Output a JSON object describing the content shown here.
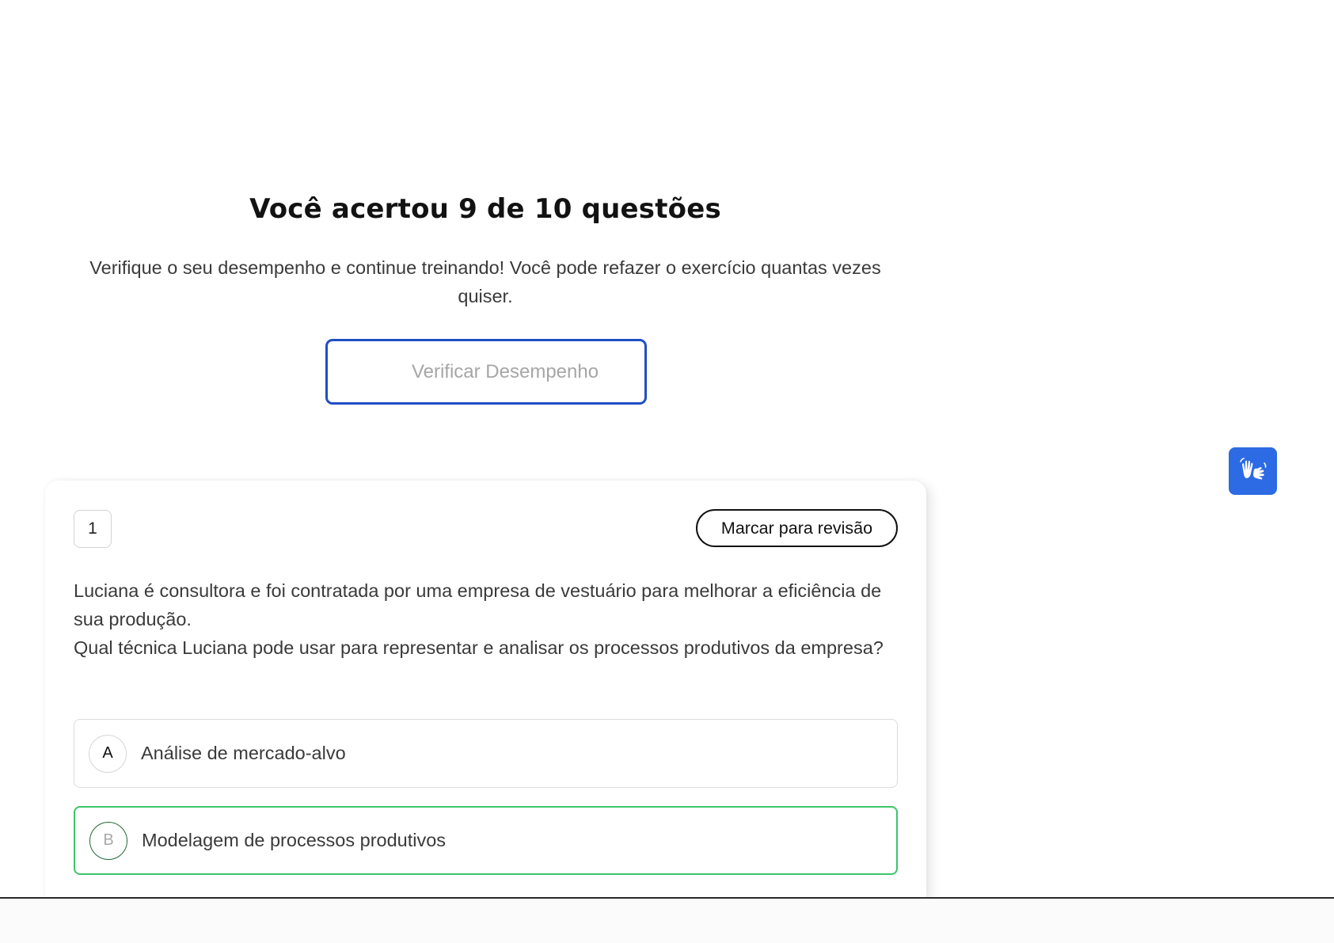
{
  "result": {
    "title": "Você acertou 9 de 10 questões",
    "description": "Verifique o seu desempenho e continue treinando! Você pode refazer o exercício quantas vezes quiser.",
    "verify_button_label": "Verificar Desempenho"
  },
  "accessibility": {
    "libras_icon": "sign-language-hands-icon",
    "accent_color": "#2c6be3"
  },
  "question": {
    "number": "1",
    "review_button_label": "Marcar para revisão",
    "text_line1": "Luciana é consultora e foi contratada por uma empresa de vestuário para melhorar a eficiência de sua produção.",
    "text_line2": "Qual técnica Luciana pode usar para representar e analisar os processos produtivos da empresa?",
    "options": [
      {
        "letter": "A",
        "text": "Análise de mercado-alvo",
        "state": "neutral"
      },
      {
        "letter": "B",
        "text": "Modelagem de processos produtivos",
        "state": "correct"
      }
    ]
  },
  "colors": {
    "primary_border": "#1f4fc2",
    "correct_border": "#3cc56a",
    "correct_letter_border": "#1f6a36"
  }
}
